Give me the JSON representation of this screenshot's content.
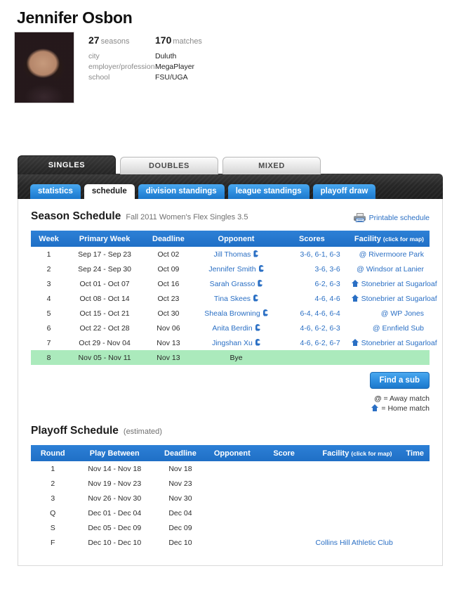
{
  "player": {
    "name": "Jennifer Osbon",
    "avatar_icon": "player-photo",
    "seasons_value": "27",
    "seasons_label": "seasons",
    "matches_value": "170",
    "matches_label": "matches",
    "fields": [
      {
        "key": "city",
        "value": "Duluth"
      },
      {
        "key": "employer/profession",
        "value": "MegaPlayer"
      },
      {
        "key": "school",
        "value": "FSU/UGA"
      }
    ]
  },
  "top_tabs": [
    {
      "label": "SINGLES",
      "active": true
    },
    {
      "label": "DOUBLES",
      "active": false
    },
    {
      "label": "MIXED",
      "active": false
    }
  ],
  "sub_tabs": [
    {
      "label": "statistics",
      "active": false
    },
    {
      "label": "schedule",
      "active": true
    },
    {
      "label": "division standings",
      "active": false
    },
    {
      "label": "league standings",
      "active": false
    },
    {
      "label": "playoff draw",
      "active": false
    }
  ],
  "season": {
    "title": "Season Schedule",
    "subtitle": "Fall 2011 Women's Flex Singles 3.5",
    "print_label": "Printable schedule",
    "print_icon": "printer-icon",
    "columns": [
      "Week",
      "Primary Week",
      "Deadline",
      "Opponent",
      "Scores",
      "Facility"
    ],
    "facility_hint": "(click for map)",
    "rows": [
      {
        "week": "1",
        "primary_week": "Sep 17 - Sep 23",
        "deadline": "Oct 02",
        "opponent": "Jill Thomas",
        "scores": "3-6, 6-1, 6-3",
        "facility": "Rivermoore Park",
        "location": "away",
        "bye": false
      },
      {
        "week": "2",
        "primary_week": "Sep 24 - Sep 30",
        "deadline": "Oct 09",
        "opponent": "Jennifer Smith",
        "scores": "3-6, 3-6",
        "facility": "Windsor at Lanier",
        "location": "away",
        "bye": false
      },
      {
        "week": "3",
        "primary_week": "Oct 01 - Oct 07",
        "deadline": "Oct 16",
        "opponent": "Sarah Grasso",
        "scores": "6-2, 6-3",
        "facility": "Stonebrier at Sugarloaf",
        "location": "home",
        "bye": false
      },
      {
        "week": "4",
        "primary_week": "Oct 08 - Oct 14",
        "deadline": "Oct 23",
        "opponent": "Tina Skees",
        "scores": "4-6, 4-6",
        "facility": "Stonebrier at Sugarloaf",
        "location": "home",
        "bye": false
      },
      {
        "week": "5",
        "primary_week": "Oct 15 - Oct 21",
        "deadline": "Oct 30",
        "opponent": "Sheala Browning",
        "scores": "6-4, 4-6, 6-4",
        "facility": "WP Jones",
        "location": "away",
        "bye": false
      },
      {
        "week": "6",
        "primary_week": "Oct 22 - Oct 28",
        "deadline": "Nov 06",
        "opponent": "Anita Berdin",
        "scores": "4-6, 6-2, 6-3",
        "facility": "Ennfield Sub",
        "location": "away",
        "bye": false
      },
      {
        "week": "7",
        "primary_week": "Oct 29 - Nov 04",
        "deadline": "Nov 13",
        "opponent": "Jingshan Xu",
        "scores": "4-6, 6-2, 6-7",
        "facility": "Stonebrier at Sugarloaf",
        "location": "home",
        "bye": false
      },
      {
        "week": "8",
        "primary_week": "Nov 05 - Nov 11",
        "deadline": "Nov 13",
        "opponent": "Bye",
        "scores": "",
        "facility": "",
        "location": "none",
        "bye": true
      }
    ],
    "find_sub_label": "Find a sub",
    "legend_away": "= Away match",
    "legend_home": "= Home match"
  },
  "playoff": {
    "title": "Playoff Schedule",
    "subtitle": "(estimated)",
    "columns": [
      "Round",
      "Play Between",
      "Deadline",
      "Opponent",
      "Score",
      "Facility",
      "Time"
    ],
    "facility_hint": "(click for map)",
    "rows": [
      {
        "round": "1",
        "play_between": "Nov 14 - Nov 18",
        "deadline": "Nov 18",
        "opponent": "",
        "score": "",
        "facility": "",
        "time": ""
      },
      {
        "round": "2",
        "play_between": "Nov 19 - Nov 23",
        "deadline": "Nov 23",
        "opponent": "",
        "score": "",
        "facility": "",
        "time": ""
      },
      {
        "round": "3",
        "play_between": "Nov 26 - Nov 30",
        "deadline": "Nov 30",
        "opponent": "",
        "score": "",
        "facility": "",
        "time": ""
      },
      {
        "round": "Q",
        "play_between": "Dec 01 - Dec 04",
        "deadline": "Dec 04",
        "opponent": "",
        "score": "",
        "facility": "",
        "time": ""
      },
      {
        "round": "S",
        "play_between": "Dec 05 - Dec 09",
        "deadline": "Dec 09",
        "opponent": "",
        "score": "",
        "facility": "",
        "time": ""
      },
      {
        "round": "F",
        "play_between": "Dec 10 - Dec 10",
        "deadline": "Dec 10",
        "opponent": "",
        "score": "",
        "facility": "Collins Hill Athletic Club",
        "time": ""
      }
    ]
  },
  "colors": {
    "header_blue": "#1f6fc6",
    "link_blue": "#2a6fc4",
    "bye_green": "#abeabc",
    "tab_dark": "#272727",
    "button_blue": "#2f8fe0"
  }
}
